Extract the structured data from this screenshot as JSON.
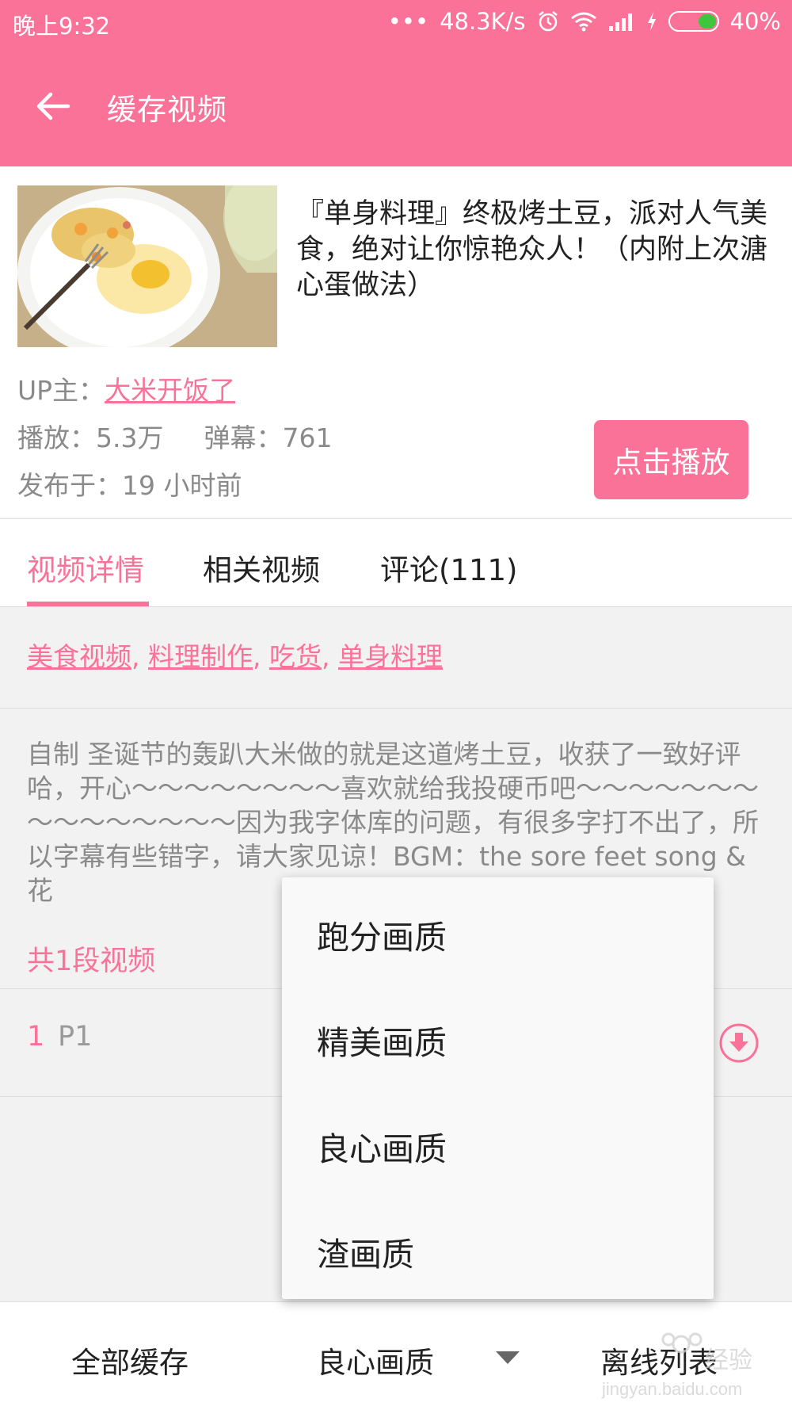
{
  "status_bar": {
    "time": "晚上9:32",
    "net_speed": "48.3K/s",
    "battery": "40%",
    "battery_level": 0.4
  },
  "toolbar": {
    "title": "缓存视频"
  },
  "video": {
    "title": "『单身料理』终极烤土豆，派对人气美食，绝对让你惊艳众人！（内附上次溏心蛋做法）",
    "up_label": "UP主：",
    "up_name": "大米开饭了",
    "plays": "播放：5.3万",
    "danmaku": "弹幕：761",
    "published": "发布于：19 小时前",
    "play_button": "点击播放"
  },
  "tabs": [
    {
      "label": "视频详情",
      "active": true
    },
    {
      "label": "相关视频",
      "active": false
    },
    {
      "label": "评论(111)",
      "active": false
    }
  ],
  "tags": [
    "美食视频",
    "料理制作",
    "吃货",
    "单身料理"
  ],
  "tag_separator": ",",
  "description": "自制 圣诞节的轰趴大米做的就是这道烤土豆，收获了一致好评哈，开心～～～～～～～～喜欢就给我投硬币吧～～～～～～～～～～～～～～～因为我字体库的问题，有很多字打不出了，所以字幕有些错字，请大家见谅！BGM：the sore feet song &  花",
  "segments_count": "共1段视频",
  "parts": [
    {
      "number": "1",
      "label": "P1"
    }
  ],
  "bottom_bar": {
    "cache_all": "全部缓存",
    "quality": "良心画质",
    "offline_list": "离线列表"
  },
  "quality_menu": {
    "options": [
      "跑分画质",
      "精美画质",
      "良心画质",
      "渣画质"
    ]
  },
  "watermark": {
    "site": "jingyan.baidu.com",
    "text": "经验"
  },
  "colors": {
    "accent": "#fb7299",
    "background": "#f2f2f2",
    "text_primary": "#222222",
    "text_secondary": "#8a8a8a"
  }
}
